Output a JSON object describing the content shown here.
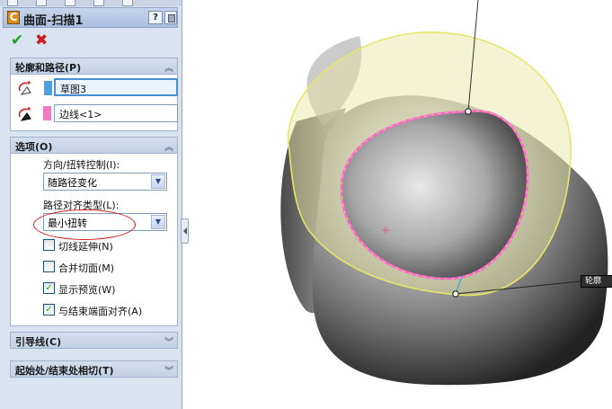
{
  "feature": {
    "title": "曲面-扫描1",
    "icon_name": "sweep-surface-icon",
    "help_label": "?"
  },
  "actions": {
    "ok_icon": "checkmark-icon",
    "cancel_icon": "close-icon"
  },
  "profile_path": {
    "header": "轮廓和路径(P)",
    "profile_value": "草图3",
    "profile_color": "#4a9fe0",
    "path_value": "边线<1>",
    "path_color": "#f07cc0"
  },
  "options": {
    "header": "选项(O)",
    "orientation_label": "方向/扭转控制(I):",
    "orientation_value": "随路径变化",
    "alignment_label": "路径对齐类型(L):",
    "alignment_value": "最小扭转",
    "checkboxes": [
      {
        "label": "切线延伸(N)",
        "checked": false
      },
      {
        "label": "合并切面(M)",
        "checked": false
      },
      {
        "label": "显示预览(W)",
        "checked": true
      },
      {
        "label": "与结束端面对齐(A)",
        "checked": true
      }
    ]
  },
  "guide_curves": {
    "header": "引导线(C)"
  },
  "tangency": {
    "header": "起始处/结束处相切(T)"
  },
  "viewport": {
    "callout_label": "轮廓",
    "accent_yellow": "#e6e66a",
    "accent_pink": "#ff66cc"
  }
}
